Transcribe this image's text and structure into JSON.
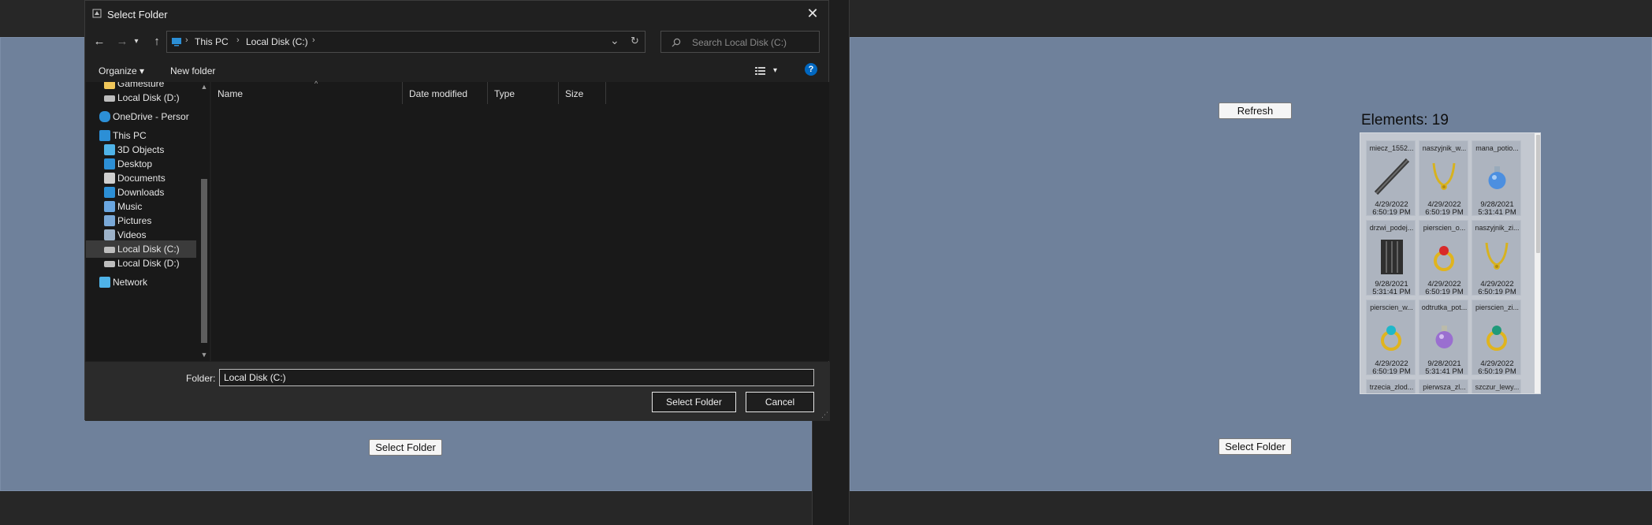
{
  "dialog": {
    "title": "Select Folder",
    "close_glyph": "✕",
    "nav": {
      "back": "←",
      "forward": "→",
      "recent": "▾",
      "up": "↑"
    },
    "address": {
      "segments": [
        "This PC",
        "Local Disk (C:)"
      ],
      "sep": "›",
      "dropdown": "⌄",
      "refresh": "↻"
    },
    "search_placeholder": "Search Local Disk (C:)",
    "commands": {
      "organize": "Organize ▾",
      "new_folder": "New folder",
      "view": "▾",
      "help": "?"
    },
    "sidebar": {
      "items": [
        {
          "label": "Gamesture",
          "icon": "folder-icon"
        },
        {
          "label": "Local Disk (D:)",
          "icon": "drive-icon"
        },
        {
          "label": "OneDrive - Persor",
          "icon": "cloud-icon"
        },
        {
          "label": "This PC",
          "icon": "computer-icon"
        },
        {
          "label": "3D Objects",
          "icon": "cube-icon"
        },
        {
          "label": "Desktop",
          "icon": "desktop-icon"
        },
        {
          "label": "Documents",
          "icon": "document-icon"
        },
        {
          "label": "Downloads",
          "icon": "download-icon"
        },
        {
          "label": "Music",
          "icon": "music-icon"
        },
        {
          "label": "Pictures",
          "icon": "picture-icon"
        },
        {
          "label": "Videos",
          "icon": "video-icon"
        },
        {
          "label": "Local Disk (C:)",
          "icon": "drive-icon"
        },
        {
          "label": "Local Disk (D:)",
          "icon": "drive-icon"
        },
        {
          "label": "Network",
          "icon": "network-icon"
        }
      ]
    },
    "columns": {
      "name": "Name",
      "date": "Date modified",
      "type": "Type",
      "size": "Size"
    },
    "folder_label": "Folder:",
    "folder_value": "Local Disk (C:)",
    "select_button": "Select Folder",
    "cancel_button": "Cancel"
  },
  "left_pane": {
    "select_button": "Select Folder"
  },
  "right_pane": {
    "refresh_button": "Refresh",
    "elements_title": "Elements: 19",
    "select_button": "Select Folder",
    "items": [
      {
        "name": "miecz_1552...",
        "date": "4/29/2022",
        "time": "6:50:19 PM",
        "icon": "sword-icon"
      },
      {
        "name": "naszyjnik_w...",
        "date": "4/29/2022",
        "time": "6:50:19 PM",
        "icon": "necklace-icon"
      },
      {
        "name": "mana_potio...",
        "date": "9/28/2021",
        "time": "5:31:41 PM",
        "icon": "potion-blue-icon"
      },
      {
        "name": "drzwi_podej...",
        "date": "9/28/2021",
        "time": "5:31:41 PM",
        "icon": "door-icon"
      },
      {
        "name": "pierscien_o...",
        "date": "4/29/2022",
        "time": "6:50:19 PM",
        "icon": "ring-red-icon"
      },
      {
        "name": "naszyjnik_zi...",
        "date": "4/29/2022",
        "time": "6:50:19 PM",
        "icon": "necklace-icon"
      },
      {
        "name": "pierscien_w...",
        "date": "4/29/2022",
        "time": "6:50:19 PM",
        "icon": "ring-cyan-icon"
      },
      {
        "name": "odtrutka_pot...",
        "date": "9/28/2021",
        "time": "5:31:41 PM",
        "icon": "potion-purple-icon"
      },
      {
        "name": "pierscien_zi...",
        "date": "4/29/2022",
        "time": "6:50:19 PM",
        "icon": "ring-green-icon"
      },
      {
        "name": "trzecia_zlod...",
        "date": "",
        "time": "",
        "icon": ""
      },
      {
        "name": "pierwsza_zl...",
        "date": "",
        "time": "",
        "icon": ""
      },
      {
        "name": "szczur_lewy...",
        "date": "",
        "time": "",
        "icon": ""
      }
    ]
  },
  "colors": {
    "pane": "#6f819b",
    "dialog": "#202020",
    "accent": "#0067c0"
  }
}
